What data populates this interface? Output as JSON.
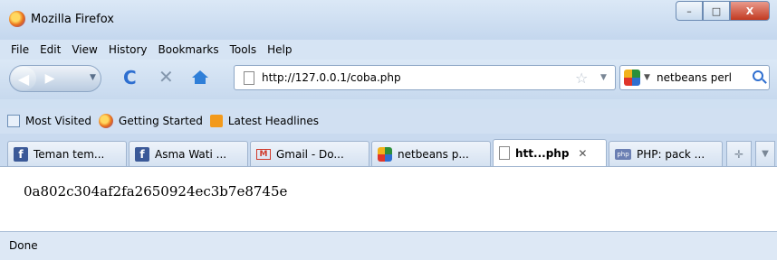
{
  "window": {
    "title": "Mozilla Firefox",
    "min_glyph": "–",
    "max_glyph": "□",
    "close_glyph": "X"
  },
  "menu": [
    "File",
    "Edit",
    "View",
    "History",
    "Bookmarks",
    "Tools",
    "Help"
  ],
  "nav": {
    "back_glyph": "◀",
    "forward_glyph": "▶",
    "reload_glyph": "C",
    "stop_glyph": "✕",
    "url": "http://127.0.0.1/coba.php",
    "search_text": "netbeans perl"
  },
  "bookmarks": [
    "Most Visited",
    "Getting Started",
    "Latest Headlines"
  ],
  "tabs": [
    {
      "label": "Teman tem...",
      "icon": "facebook-icon"
    },
    {
      "label": "Asma Wati ...",
      "icon": "facebook-icon"
    },
    {
      "label": "Gmail - Do...",
      "icon": "gmail-icon"
    },
    {
      "label": "netbeans p...",
      "icon": "google-icon"
    },
    {
      "label": "htt...php",
      "icon": "page-icon",
      "active": true
    },
    {
      "label": "PHP: pack ...",
      "icon": "php-icon"
    }
  ],
  "content": {
    "text": "0a802c304af2fa2650924ec3b7e8745e"
  },
  "status": {
    "text": "Done"
  },
  "colors": {
    "titlebar": "#c4d7ee",
    "close_button": "#c23a21",
    "link_blue": "#2f6fd0"
  }
}
